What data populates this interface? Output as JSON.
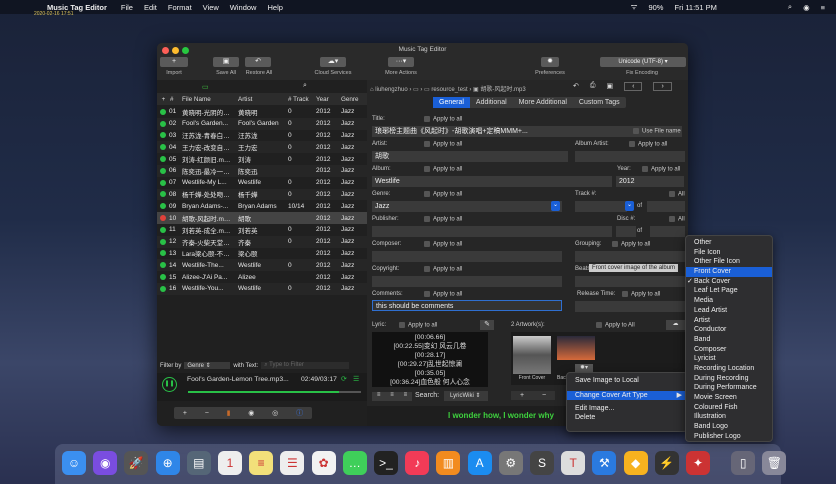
{
  "menubar": {
    "app": "Music Tag Editor",
    "items": [
      "File",
      "Edit",
      "Format",
      "View",
      "Window",
      "Help"
    ],
    "battery": "90%",
    "clock": "Fri 11:51 PM",
    "stamp": "2020-02-16 17:51"
  },
  "window": {
    "title": "Music Tag Editor"
  },
  "toolbar": {
    "import": "Import",
    "save_all": "Save All",
    "restore_all": "Restore All",
    "cloud": "Cloud Services",
    "more": "More Actions",
    "prefs": "Preferences",
    "encoding": "Unicode (UTF-8)",
    "fix_encoding": "Fix Encoding"
  },
  "table": {
    "headers": [
      "#",
      "File Name",
      "Artist",
      "# Track",
      "Year",
      "Genre"
    ],
    "rows": [
      [
        "01",
        "黄晓明-光阴的…",
        "黄晓明",
        "0",
        "2012",
        "Jazz"
      ],
      [
        "02",
        "Fool's Garden...",
        "Fool's Garden",
        "0",
        "2012",
        "Jazz"
      ],
      [
        "03",
        "汪苏泷-青春白…",
        "汪苏泷",
        "0",
        "2012",
        "Jazz"
      ],
      [
        "04",
        "王力宏-改变自…",
        "王力宏",
        "0",
        "2012",
        "Jazz"
      ],
      [
        "05",
        "刘涛-红颜旧.m…",
        "刘涛",
        "0",
        "2012",
        "Jazz"
      ],
      [
        "06",
        "陈奕迅-最冷一…",
        "陈奕迅",
        "",
        "2012",
        "Jazz"
      ],
      [
        "07",
        "Westlife-My L...",
        "Westlife",
        "0",
        "2012",
        "Jazz"
      ],
      [
        "08",
        "杨千嬅-处处吻…",
        "杨千嬅",
        "0",
        "2012",
        "Jazz"
      ],
      [
        "09",
        "Bryan Adams-...",
        "Bryan Adams",
        "10/14",
        "2012",
        "Jazz"
      ],
      [
        "10",
        "胡歌-风起时.m…",
        "胡歌",
        "",
        "2012",
        "Jazz"
      ],
      [
        "11",
        "刘若英-成全.m…",
        "刘若英",
        "0",
        "2012",
        "Jazz"
      ],
      [
        "12",
        "齐秦-火柴天堂…",
        "齐秦",
        "0",
        "2012",
        "Jazz"
      ],
      [
        "13",
        "Lara梁心颐-不…",
        "梁心颐",
        "",
        "2012",
        "Jazz"
      ],
      [
        "14",
        "Westlife-The...",
        "Westlife",
        "0",
        "2012",
        "Jazz"
      ],
      [
        "15",
        "Alizee-J'Ai Pa...",
        "Alizee",
        "",
        "2012",
        "Jazz"
      ],
      [
        "16",
        "Westlife-You...",
        "Westlife",
        "0",
        "2012",
        "Jazz"
      ]
    ]
  },
  "filter": {
    "label": "Filter by",
    "value": "Genre",
    "with_text": "with Text:",
    "placeholder": "Type to Filter"
  },
  "player": {
    "track": "Fool's Garden-Lemon Tree.mp3...",
    "time": "02:49/03:17",
    "progress": 0.87
  },
  "breadcrumb": [
    "liuhengzhuo",
    "resource_test",
    "胡歌-风起时.mp3"
  ],
  "tabs": [
    "General",
    "Additional",
    "More Additional",
    "Custom Tags"
  ],
  "form": {
    "apply": "Apply to all",
    "title_label": "Title:",
    "title": "琅琊榜主题曲《风起时》-胡歌演唱+定稿MMM+...",
    "use_file_name": "Use File name",
    "artist_label": "Artist:",
    "artist": "胡歌",
    "album_artist_label": "Album Artist:",
    "album_label": "Album:",
    "album": "Westlife",
    "year_label": "Year:",
    "year": "2012",
    "genre_label": "Genre:",
    "genre": "Jazz",
    "track_label": "Track #:",
    "all": "All",
    "of": "of",
    "publisher_label": "Publisher:",
    "disc_label": "Disc #:",
    "composer_label": "Composer:",
    "grouping_label": "Grouping:",
    "copyright_label": "Copyright:",
    "beats_label": "Beats P",
    "comments_label": "Comments:",
    "comments": "this should be comments",
    "release_label": "Release Time:",
    "lyric_label": "Lyric:",
    "artworks_label": "2 Artwork(s):",
    "apply_All": "Apply to All",
    "lyrics": [
      "[00:06.66]",
      "[00:22.55]变幻 风云几卷",
      "[00:28.17]",
      "[00:29.27]乱世起惊澜",
      "[00:35.05]",
      "[00:36.24]血色般 何人心念"
    ],
    "search_label": "Search:",
    "search_source": "LyricWiki",
    "front_cover": "Front Cover",
    "back": "Back",
    "now_lyric": "I wonder how, I wonder why"
  },
  "tooltip": "Front cover image of the album",
  "context_menu": [
    "Save Image to Local",
    "Change Cover Art Type",
    "Edit Image...",
    "Delete"
  ],
  "submenu": {
    "items": [
      "Other",
      "File Icon",
      "Other File Icon",
      "Front Cover",
      "Back Cover",
      "Leaf Let Page",
      "Media",
      "Lead Artist",
      "Artist",
      "Conductor",
      "Band",
      "Composer",
      "Lyricist",
      "Recording Location",
      "During Recording",
      "During Performance",
      "Movie Screen",
      "Coloured Fish",
      "Illustration",
      "Band Logo",
      "Publisher Logo"
    ],
    "highlighted": "Front Cover",
    "checked": "Back Cover"
  },
  "colors": {
    "accent": "#1a5fd6",
    "green": "#29c147",
    "lyric_green": "#3ed13e"
  }
}
